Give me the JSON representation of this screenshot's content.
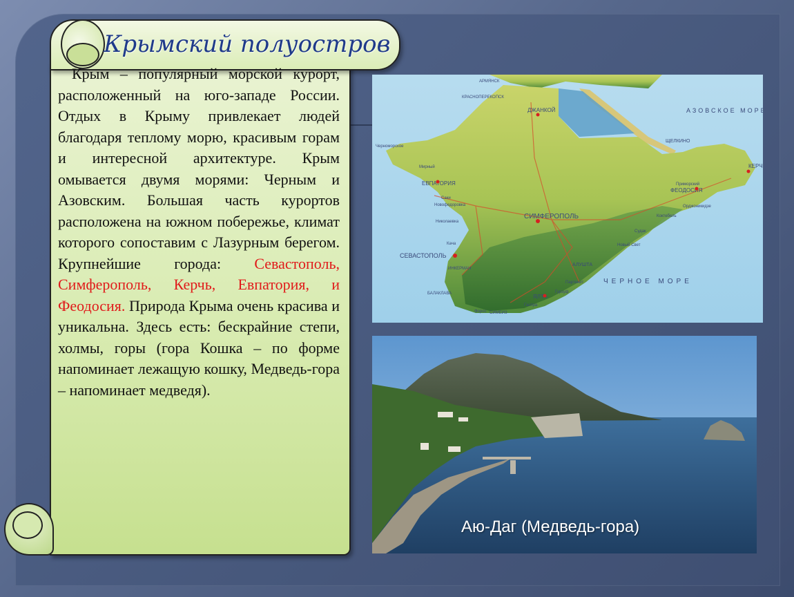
{
  "slide": {
    "title": "Крымский полуостров",
    "body_pre": "Крым – популярный морской курорт, расположенный на юго-западе России. Отдых в Крыму привлекает людей благодаря теплому морю, красивым горам и интересной архитектуре. Крым омывается двумя морями: Черным и Азовским. Большая часть курортов расположена на южном побережье, климат которого сопоставим с Лазурным берегом. Крупнейшие города: ",
    "body_cities": "Севастополь, Симферополь, Керчь, Евпатория, и Феодосия.",
    "body_post": " Природа Крыма очень красива и уникальна. Здесь есть: бескрайние степи, холмы, горы (гора Кошка – по форме напоминает лежащую кошку, Медведь-гора – напоминает медведя).",
    "photo_caption": "Аю-Даг (Медведь-гора)"
  },
  "map": {
    "sea_azov": "АЗОВСКОЕ МОРЕ",
    "sea_black": "ЧЕРНОЕ МОРЕ",
    "cities": {
      "armyansk": "АРМЯНСК",
      "krasnoperekopsk": "КРАСНОПЕРЕКОПСК",
      "dzhankoy": "ДЖАНКОЙ",
      "chernomorskoe": "Черноморское",
      "shchelkino": "ЩЕЛКИНО",
      "kerch": "КЕРЧ",
      "evpatoria": "ЕВПАТОРИЯ",
      "feodosia": "ФЕОДОСИЯ",
      "simferopol": "СИМФЕРОПОЛЬ",
      "sevastopol": "СЕВАСТОПОЛЬ",
      "alushta": "АЛУШТА",
      "yalta": "ЯЛТА",
      "sudak": "Судак",
      "mirny": "Мирный",
      "saki": "Саки",
      "novofedorovka": "Новофедоровка",
      "nikolaevka": "Николаевка",
      "kacha": "Кача",
      "koktebel": "Коктебель",
      "ordzhonikidze": "Орджоникидзе",
      "primorsky": "Приморский",
      "novy_svet": "Новый Свет",
      "partenit": "Партенит",
      "gurzuf": "Гурзуф",
      "gaspra": "Гаспра",
      "foros": "Форос",
      "simeiz": "СИМЕИЗ",
      "balaklava": "БАЛАКЛАВА",
      "inkerman": "ИНКЕРМАН"
    }
  },
  "colors": {
    "title": "#1f3a8a",
    "cities_highlight": "#e01b1b",
    "scroll_fill": "#d8ebb0",
    "background": "#52658c"
  }
}
